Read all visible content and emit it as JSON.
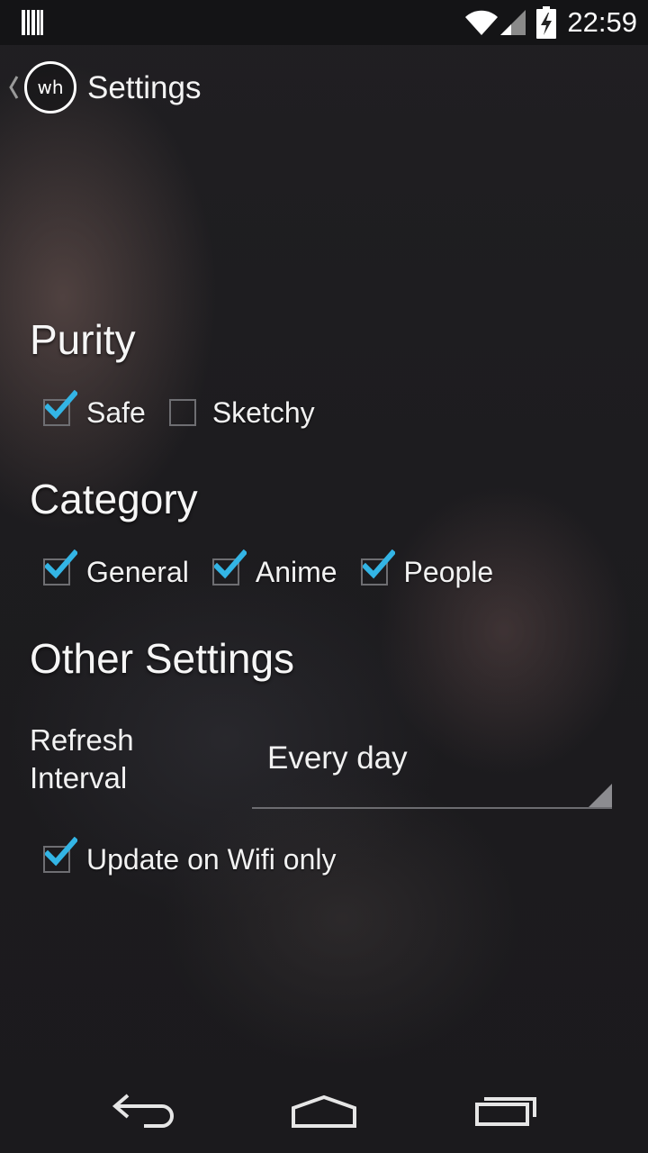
{
  "status_bar": {
    "time": "22:59",
    "left_icon": "barcode-notification-icon",
    "icons": [
      "wifi-icon",
      "cell-signal-icon",
      "battery-charging-icon"
    ]
  },
  "action_bar": {
    "logo_text": "wh",
    "title": "Settings"
  },
  "sections": {
    "purity": {
      "title": "Purity",
      "options": [
        {
          "label": "Safe",
          "checked": true
        },
        {
          "label": "Sketchy",
          "checked": false
        }
      ]
    },
    "category": {
      "title": "Category",
      "options": [
        {
          "label": "General",
          "checked": true
        },
        {
          "label": "Anime",
          "checked": true
        },
        {
          "label": "People",
          "checked": true
        }
      ]
    },
    "other": {
      "title": "Other Settings",
      "refresh_label": "Refresh Interval",
      "refresh_value": "Every day",
      "wifi_label": "Update on Wifi only",
      "wifi_checked": true
    }
  },
  "nav_bar": {
    "icons": [
      "back-icon",
      "home-icon",
      "recent-apps-icon"
    ]
  },
  "colors": {
    "accent": "#33b5e5",
    "checkbox_border": "#6e6e72",
    "background": "#1d1c1f"
  }
}
